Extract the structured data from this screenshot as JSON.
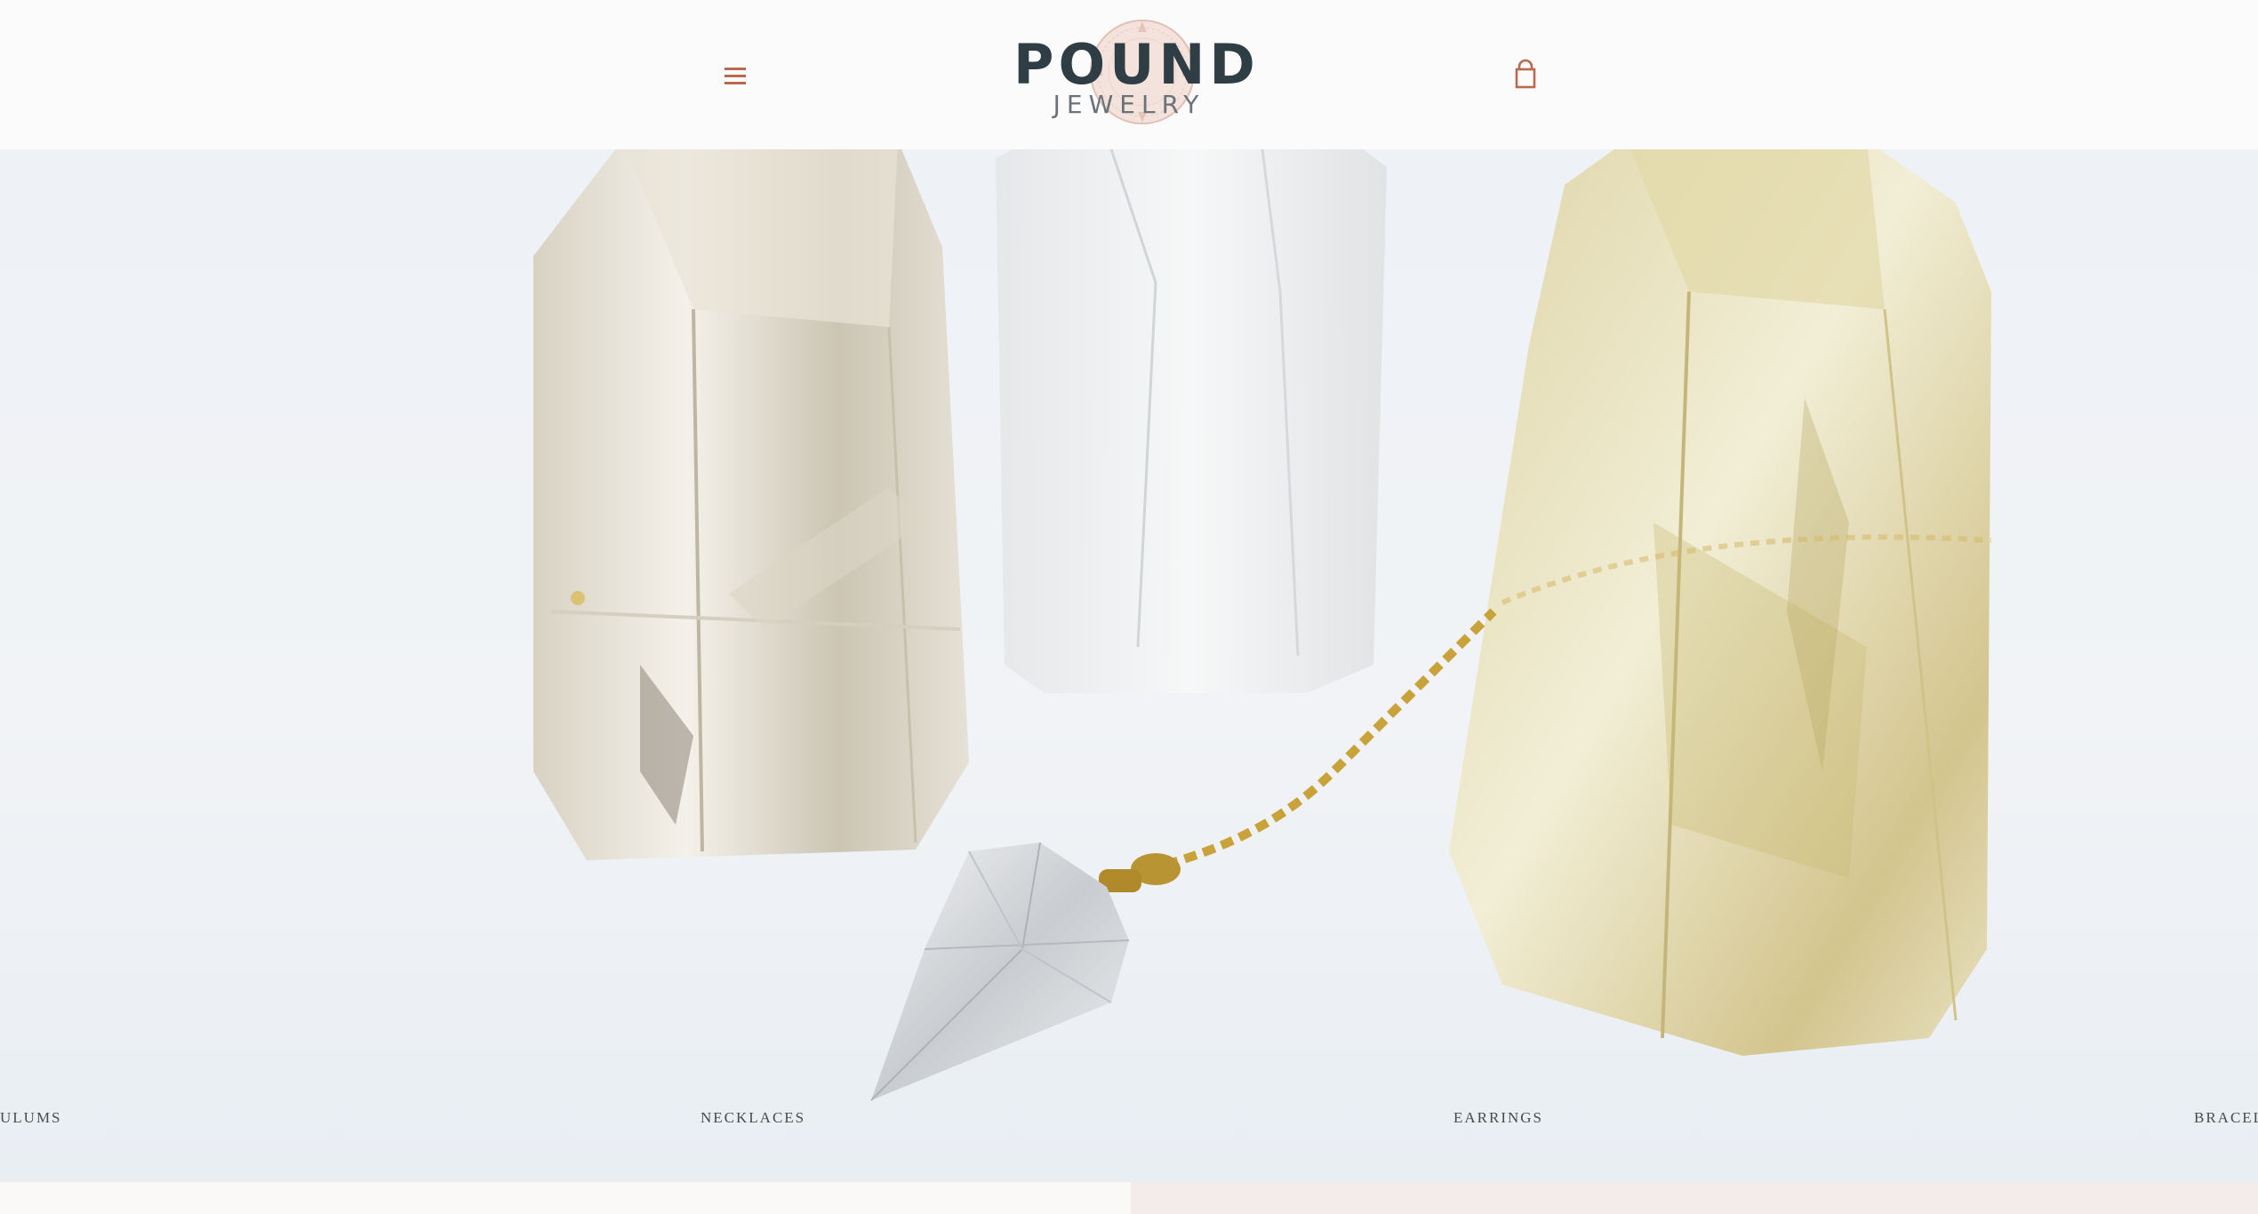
{
  "header": {
    "menu_icon": "hamburger-icon",
    "logo_text": "POUND",
    "logo_subtext": "JEWELRY",
    "cart_icon": "shopping-bag-icon"
  },
  "hero": {
    "collections": [
      {
        "label": "ULUMS"
      },
      {
        "label": "NECKLACES"
      },
      {
        "label": "EARRINGS"
      },
      {
        "label": "BRACEL"
      }
    ]
  },
  "colors": {
    "accent": "#b8694e",
    "logo_dark": "#2f3d45",
    "seal_pink": "#e8c8bd",
    "chain_gold": "#c9a23a",
    "bottom_right": "#f4ecea"
  }
}
